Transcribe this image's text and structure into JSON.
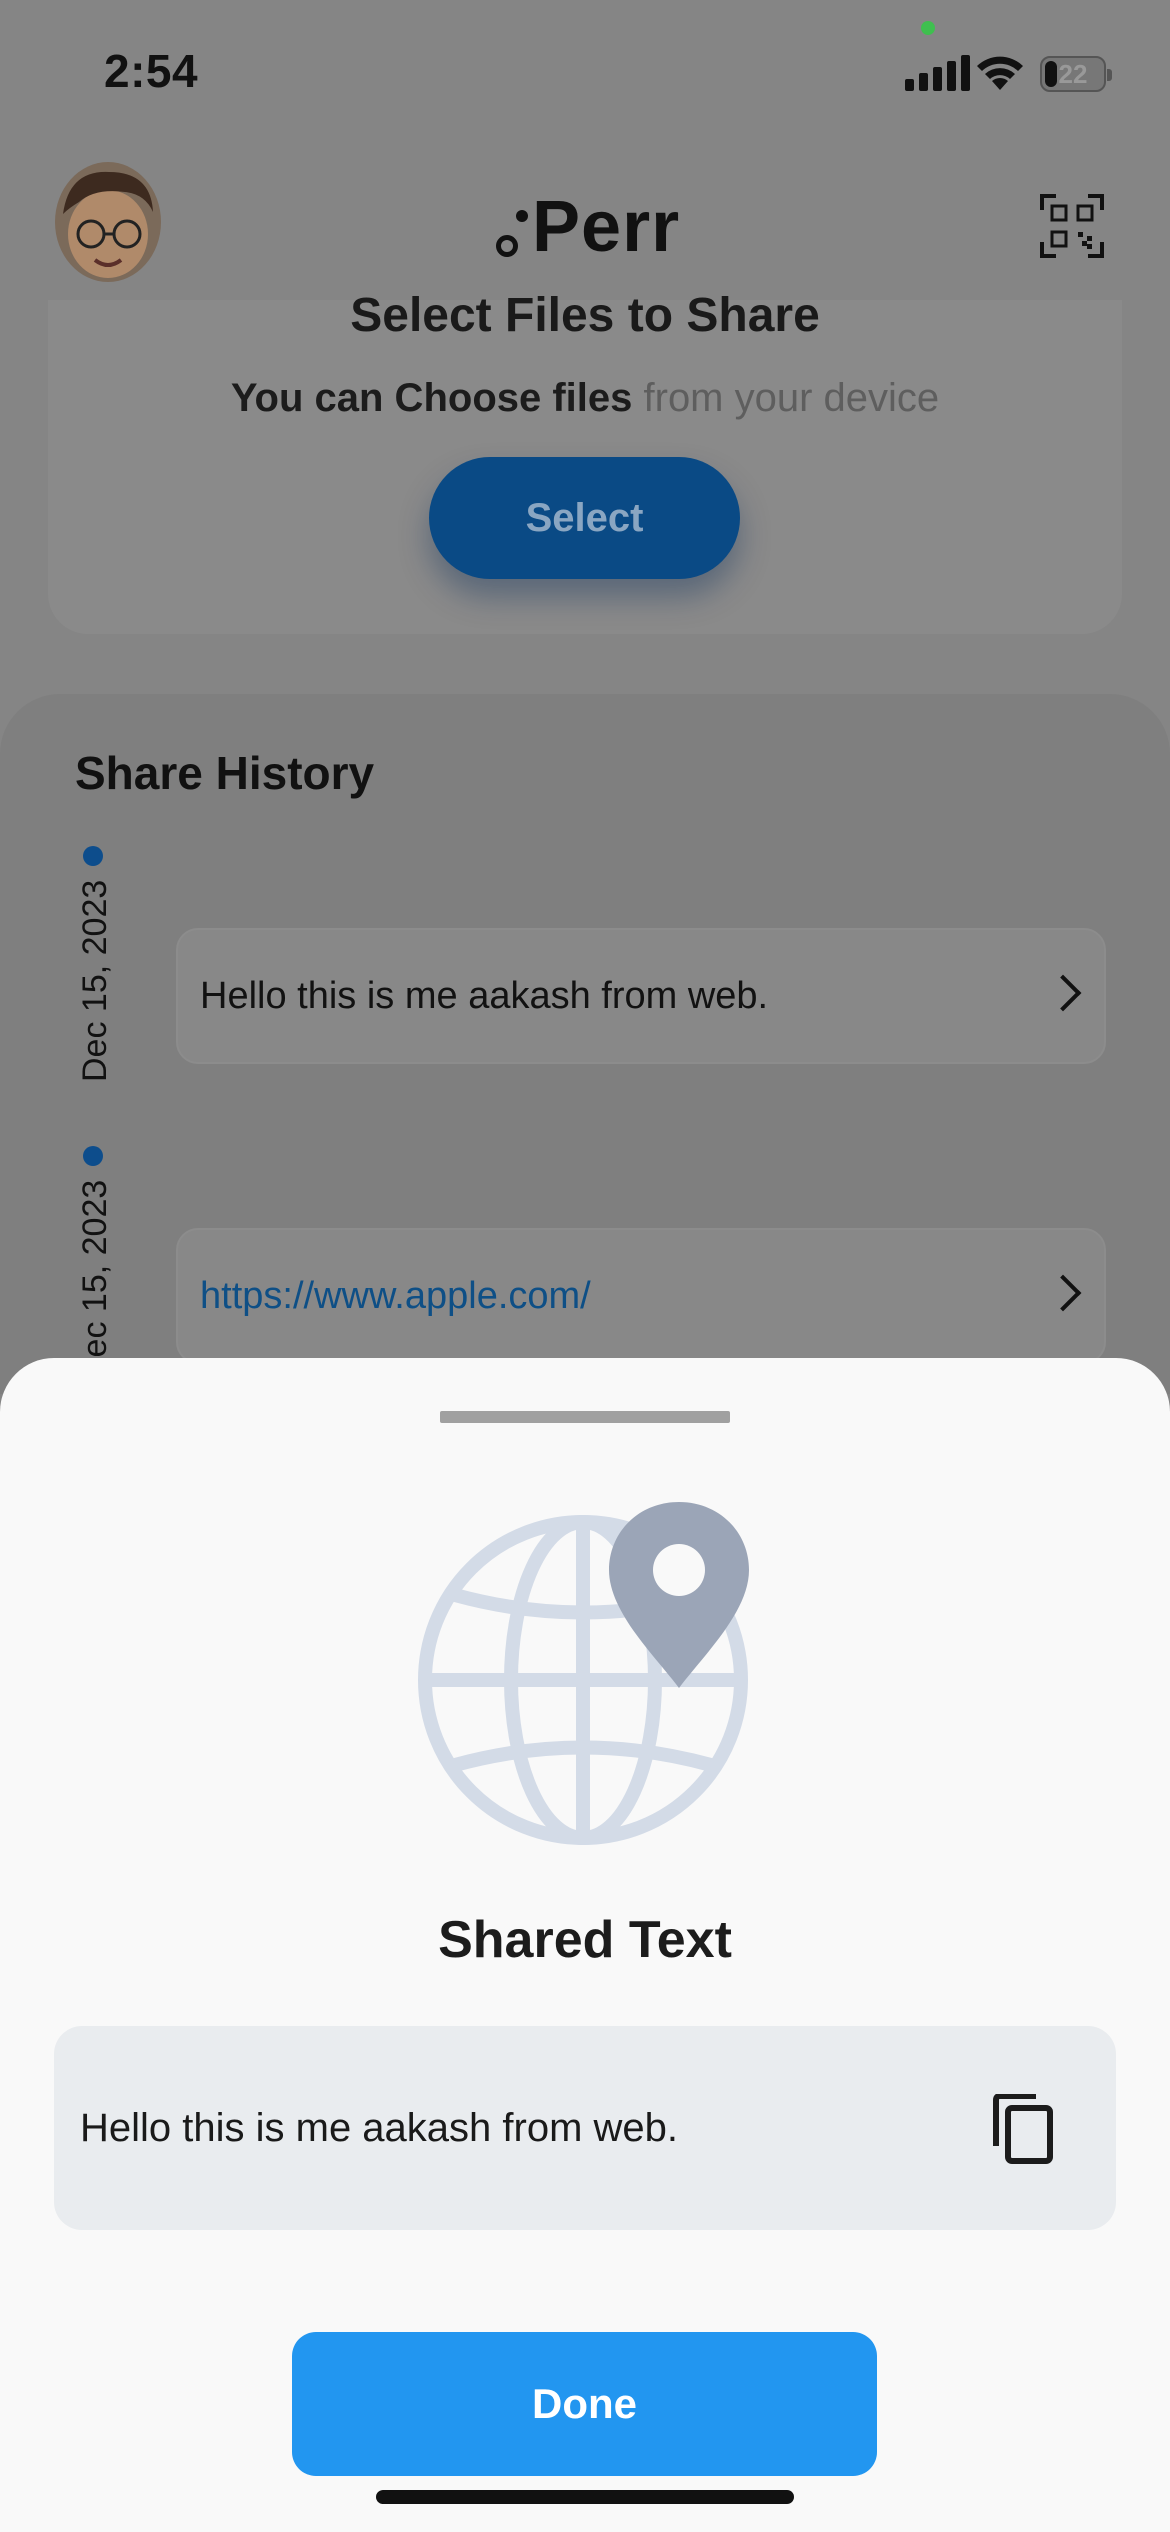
{
  "status_bar": {
    "time": "2:54",
    "battery": "22"
  },
  "header": {
    "logo": "Perr"
  },
  "select_card": {
    "title": "Select Files to Share",
    "subtitle_bold": "You can Choose files",
    "subtitle_rest": " from your device",
    "button": "Select"
  },
  "history": {
    "title": "Share History",
    "items": [
      {
        "date": "Dec 15, 2023",
        "text": "Hello this is me aakash from web."
      },
      {
        "date": "Dec 15, 2023",
        "text": "https://www.apple.com/"
      }
    ]
  },
  "sheet": {
    "title": "Shared Text",
    "text": "Hello this is me aakash from web.",
    "done_button": "Done"
  },
  "colors": {
    "accent": "#2296f0",
    "select_button": "#0a4a85",
    "link": "#0e4f86"
  }
}
